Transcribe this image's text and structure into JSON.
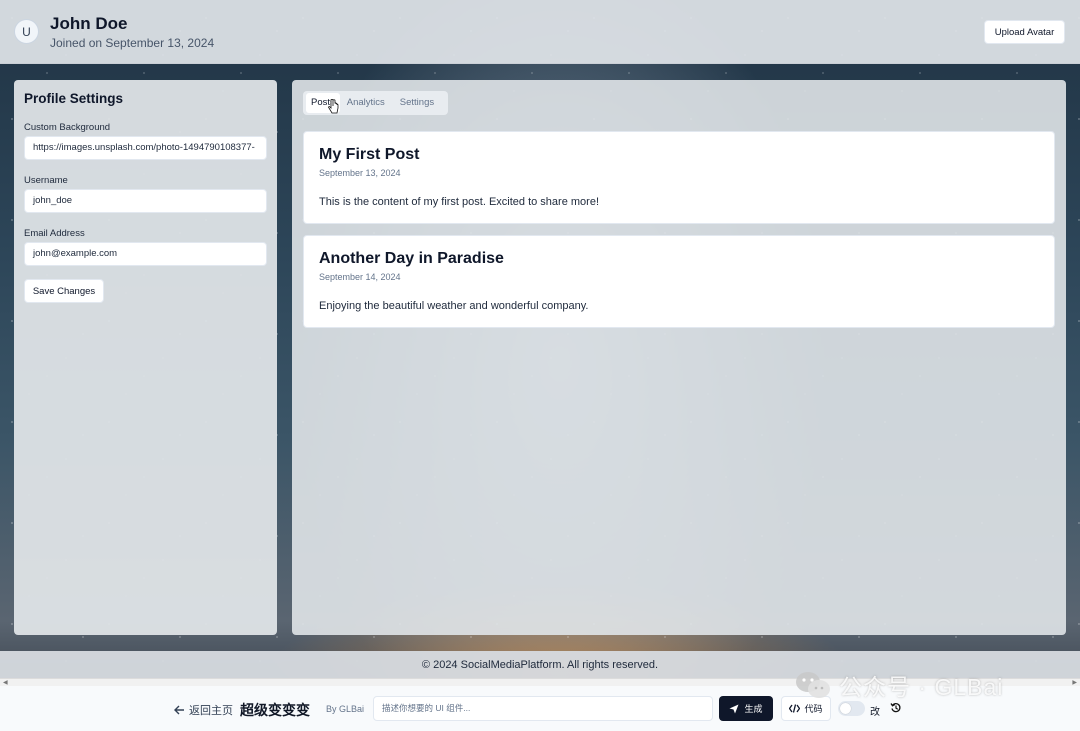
{
  "header": {
    "avatar_initial": "U",
    "user_name": "John Doe",
    "joined": "Joined on September 13, 2024",
    "upload_button": "Upload Avatar"
  },
  "settings": {
    "title": "Profile Settings",
    "background_label": "Custom Background",
    "background_value": "https://images.unsplash.com/photo-1494790108377-",
    "username_label": "Username",
    "username_value": "john_doe",
    "email_label": "Email Address",
    "email_value": "john@example.com",
    "save_button": "Save Changes"
  },
  "tabs": [
    {
      "label": "Posts",
      "active": true
    },
    {
      "label": "Analytics",
      "active": false
    },
    {
      "label": "Settings",
      "active": false
    }
  ],
  "posts": [
    {
      "title": "My First Post",
      "date": "September 13, 2024",
      "content": "This is the content of my first post. Excited to share more!"
    },
    {
      "title": "Another Day in Paradise",
      "date": "September 14, 2024",
      "content": "Enjoying the beautiful weather and wonderful company."
    }
  ],
  "footer": {
    "text": "© 2024 SocialMediaPlatform. All rights reserved."
  },
  "toolbar": {
    "back_label": "返回主页",
    "brand_title": "超级变变变",
    "by_text": "By GLBai",
    "prompt_placeholder": "描述你想要的 UI 组件...",
    "generate_label": "生成",
    "code_label": "代码",
    "edit_label": "改"
  },
  "watermark": {
    "text": "公众号 · GLBai"
  },
  "colors": {
    "primary_dark": "#0f172a",
    "muted_text": "#64748b",
    "card_bg": "#ffffff"
  }
}
